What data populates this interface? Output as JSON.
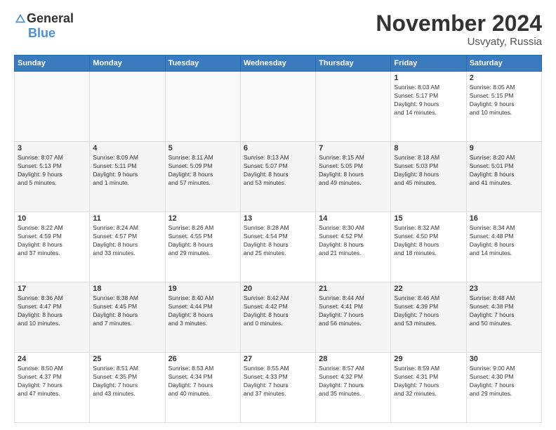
{
  "header": {
    "logo_general": "General",
    "logo_blue": "Blue",
    "month_title": "November 2024",
    "location": "Usvyaty, Russia"
  },
  "weekdays": [
    "Sunday",
    "Monday",
    "Tuesday",
    "Wednesday",
    "Thursday",
    "Friday",
    "Saturday"
  ],
  "weeks": [
    [
      {
        "day": "",
        "info": ""
      },
      {
        "day": "",
        "info": ""
      },
      {
        "day": "",
        "info": ""
      },
      {
        "day": "",
        "info": ""
      },
      {
        "day": "",
        "info": ""
      },
      {
        "day": "1",
        "info": "Sunrise: 8:03 AM\nSunset: 5:17 PM\nDaylight: 9 hours\nand 14 minutes."
      },
      {
        "day": "2",
        "info": "Sunrise: 8:05 AM\nSunset: 5:15 PM\nDaylight: 9 hours\nand 10 minutes."
      }
    ],
    [
      {
        "day": "3",
        "info": "Sunrise: 8:07 AM\nSunset: 5:13 PM\nDaylight: 9 hours\nand 5 minutes."
      },
      {
        "day": "4",
        "info": "Sunrise: 8:09 AM\nSunset: 5:11 PM\nDaylight: 9 hours\nand 1 minute."
      },
      {
        "day": "5",
        "info": "Sunrise: 8:11 AM\nSunset: 5:09 PM\nDaylight: 8 hours\nand 57 minutes."
      },
      {
        "day": "6",
        "info": "Sunrise: 8:13 AM\nSunset: 5:07 PM\nDaylight: 8 hours\nand 53 minutes."
      },
      {
        "day": "7",
        "info": "Sunrise: 8:15 AM\nSunset: 5:05 PM\nDaylight: 8 hours\nand 49 minutes."
      },
      {
        "day": "8",
        "info": "Sunrise: 8:18 AM\nSunset: 5:03 PM\nDaylight: 8 hours\nand 45 minutes."
      },
      {
        "day": "9",
        "info": "Sunrise: 8:20 AM\nSunset: 5:01 PM\nDaylight: 8 hours\nand 41 minutes."
      }
    ],
    [
      {
        "day": "10",
        "info": "Sunrise: 8:22 AM\nSunset: 4:59 PM\nDaylight: 8 hours\nand 37 minutes."
      },
      {
        "day": "11",
        "info": "Sunrise: 8:24 AM\nSunset: 4:57 PM\nDaylight: 8 hours\nand 33 minutes."
      },
      {
        "day": "12",
        "info": "Sunrise: 8:26 AM\nSunset: 4:55 PM\nDaylight: 8 hours\nand 29 minutes."
      },
      {
        "day": "13",
        "info": "Sunrise: 8:28 AM\nSunset: 4:54 PM\nDaylight: 8 hours\nand 25 minutes."
      },
      {
        "day": "14",
        "info": "Sunrise: 8:30 AM\nSunset: 4:52 PM\nDaylight: 8 hours\nand 21 minutes."
      },
      {
        "day": "15",
        "info": "Sunrise: 8:32 AM\nSunset: 4:50 PM\nDaylight: 8 hours\nand 18 minutes."
      },
      {
        "day": "16",
        "info": "Sunrise: 8:34 AM\nSunset: 4:48 PM\nDaylight: 8 hours\nand 14 minutes."
      }
    ],
    [
      {
        "day": "17",
        "info": "Sunrise: 8:36 AM\nSunset: 4:47 PM\nDaylight: 8 hours\nand 10 minutes."
      },
      {
        "day": "18",
        "info": "Sunrise: 8:38 AM\nSunset: 4:45 PM\nDaylight: 8 hours\nand 7 minutes."
      },
      {
        "day": "19",
        "info": "Sunrise: 8:40 AM\nSunset: 4:44 PM\nDaylight: 8 hours\nand 3 minutes."
      },
      {
        "day": "20",
        "info": "Sunrise: 8:42 AM\nSunset: 4:42 PM\nDaylight: 8 hours\nand 0 minutes."
      },
      {
        "day": "21",
        "info": "Sunrise: 8:44 AM\nSunset: 4:41 PM\nDaylight: 7 hours\nand 56 minutes."
      },
      {
        "day": "22",
        "info": "Sunrise: 8:46 AM\nSunset: 4:39 PM\nDaylight: 7 hours\nand 53 minutes."
      },
      {
        "day": "23",
        "info": "Sunrise: 8:48 AM\nSunset: 4:38 PM\nDaylight: 7 hours\nand 50 minutes."
      }
    ],
    [
      {
        "day": "24",
        "info": "Sunrise: 8:50 AM\nSunset: 4:37 PM\nDaylight: 7 hours\nand 47 minutes."
      },
      {
        "day": "25",
        "info": "Sunrise: 8:51 AM\nSunset: 4:35 PM\nDaylight: 7 hours\nand 43 minutes."
      },
      {
        "day": "26",
        "info": "Sunrise: 8:53 AM\nSunset: 4:34 PM\nDaylight: 7 hours\nand 40 minutes."
      },
      {
        "day": "27",
        "info": "Sunrise: 8:55 AM\nSunset: 4:33 PM\nDaylight: 7 hours\nand 37 minutes."
      },
      {
        "day": "28",
        "info": "Sunrise: 8:57 AM\nSunset: 4:32 PM\nDaylight: 7 hours\nand 35 minutes."
      },
      {
        "day": "29",
        "info": "Sunrise: 8:59 AM\nSunset: 4:31 PM\nDaylight: 7 hours\nand 32 minutes."
      },
      {
        "day": "30",
        "info": "Sunrise: 9:00 AM\nSunset: 4:30 PM\nDaylight: 7 hours\nand 29 minutes."
      }
    ]
  ]
}
